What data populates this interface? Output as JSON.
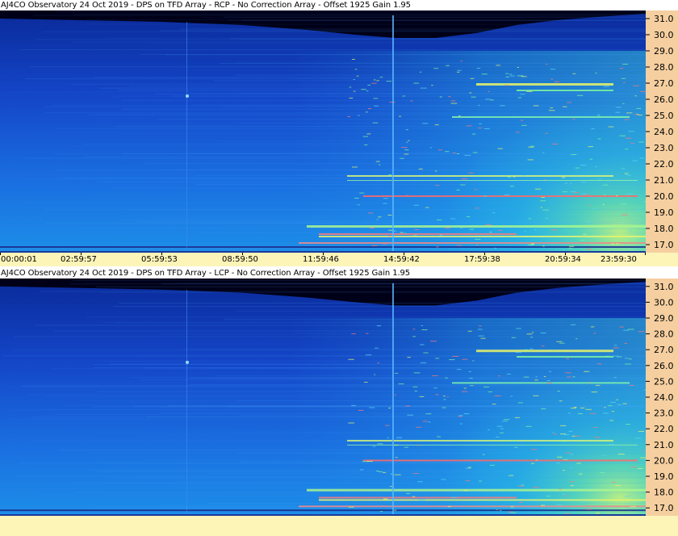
{
  "panels": [
    {
      "id": "rcp",
      "title": "AJ4CO Observatory 24 Oct 2019 - DPS on TFD Array  - RCP  -  No Correction Array  -  Offset 1925  Gain 1.95",
      "freq_ticks": [
        "31.0",
        "30.0",
        "29.0",
        "28.0",
        "27.0",
        "26.0",
        "25.0",
        "24.0",
        "23.0",
        "22.0",
        "21.0",
        "20.0",
        "19.0",
        "18.0",
        "17.0"
      ],
      "time_ticks": [
        "00:00:01",
        "02:59:57",
        "05:59:53",
        "08:59:50",
        "11:59:46",
        "14:59:42",
        "17:59:38",
        "20:59:34",
        "23:59:30"
      ]
    },
    {
      "id": "lcp",
      "title": "AJ4CO Observatory 24 Oct 2019 - DPS on TFD Array  - LCP  -  No Correction Array  -  Offset 1925  Gain 1.95",
      "freq_ticks": [
        "31.0",
        "30.0",
        "29.0",
        "28.0",
        "27.0",
        "26.0",
        "25.0",
        "24.0",
        "23.0",
        "22.0",
        "21.0",
        "20.0",
        "19.0",
        "18.0",
        "17.0"
      ]
    }
  ],
  "chart_data": [
    {
      "type": "heatmap",
      "title": "AJ4CO Observatory 24 Oct 2019 - DPS on TFD Array  - RCP  -  No Correction Array  -  Offset 1925  Gain 1.95",
      "xlabel": "",
      "ylabel": "",
      "x_ticks": [
        "00:00:01",
        "02:59:57",
        "05:59:53",
        "08:59:50",
        "11:59:46",
        "14:59:42",
        "17:59:38",
        "20:59:34",
        "23:59:30"
      ],
      "y_ticks": [
        31.0,
        30.0,
        29.0,
        28.0,
        27.0,
        26.0,
        25.0,
        24.0,
        23.0,
        22.0,
        21.0,
        20.0,
        19.0,
        18.0,
        17.0
      ],
      "ylim": [
        16.5,
        31.5
      ],
      "colormap": [
        "#000020",
        "#0a1f8a",
        "#1d57d8",
        "#1e8fe8",
        "#22d3e6",
        "#7ff5a0",
        "#f6f25a",
        "#ff5a5a"
      ]
    },
    {
      "type": "heatmap",
      "title": "AJ4CO Observatory 24 Oct 2019 - DPS on TFD Array  - LCP  -  No Correction Array  -  Offset 1925  Gain 1.95",
      "xlabel": "",
      "ylabel": "",
      "y_ticks": [
        31.0,
        30.0,
        29.0,
        28.0,
        27.0,
        26.0,
        25.0,
        24.0,
        23.0,
        22.0,
        21.0,
        20.0,
        19.0,
        18.0,
        17.0
      ],
      "ylim": [
        16.5,
        31.5
      ],
      "colormap": [
        "#000020",
        "#0a1f8a",
        "#1d57d8",
        "#1e8fe8",
        "#22d3e6",
        "#7ff5a0",
        "#f6f25a",
        "#ff5a5a"
      ]
    }
  ]
}
